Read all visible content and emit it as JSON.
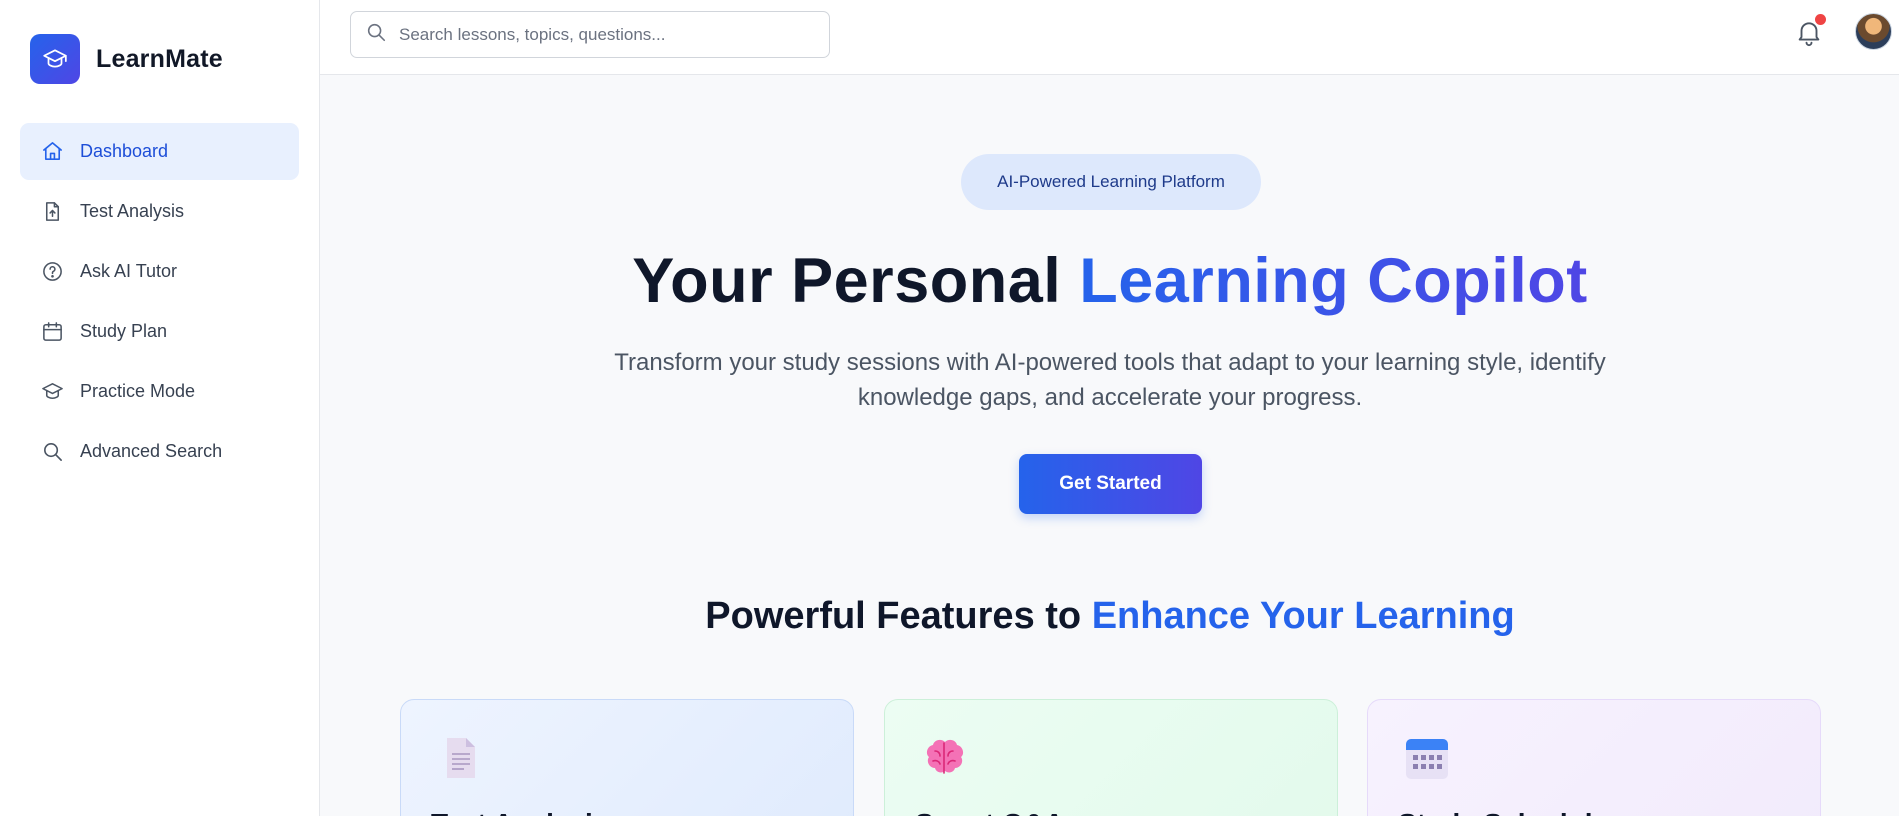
{
  "app": {
    "name": "LearnMate",
    "logo_icon": "graduation-cap-icon",
    "accent_color": "#2563eb",
    "accent_color_2": "#4f46e5"
  },
  "sidebar": {
    "items": [
      {
        "label": "Dashboard",
        "icon": "home-icon",
        "active": true
      },
      {
        "label": "Test Analysis",
        "icon": "file-upload-icon",
        "active": false
      },
      {
        "label": "Ask AI Tutor",
        "icon": "help-circle-icon",
        "active": false
      },
      {
        "label": "Study Plan",
        "icon": "calendar-icon",
        "active": false
      },
      {
        "label": "Practice Mode",
        "icon": "graduation-cap-icon",
        "active": false
      },
      {
        "label": "Advanced Search",
        "icon": "search-icon",
        "active": false
      }
    ]
  },
  "topbar": {
    "search_placeholder": "Search lessons, topics, questions...",
    "search_value": "",
    "notification_badge_color": "#ef4444"
  },
  "hero": {
    "badge": "AI-Powered Learning Platform",
    "title_plain": "Your Personal ",
    "title_accent": "Learning Copilot",
    "subtitle": "Transform your study sessions with AI-powered tools that adapt to your learning style, identify knowledge gaps, and accelerate your progress.",
    "cta_label": "Get Started"
  },
  "features": {
    "title_plain": "Powerful Features to ",
    "title_accent": "Enhance Your Learning",
    "cards": [
      {
        "title": "Test Analysis",
        "icon": "document-icon"
      },
      {
        "title": "Smart Q&A",
        "icon": "brain-icon"
      },
      {
        "title": "Study Schedules",
        "icon": "calendar-grid-icon"
      }
    ]
  }
}
